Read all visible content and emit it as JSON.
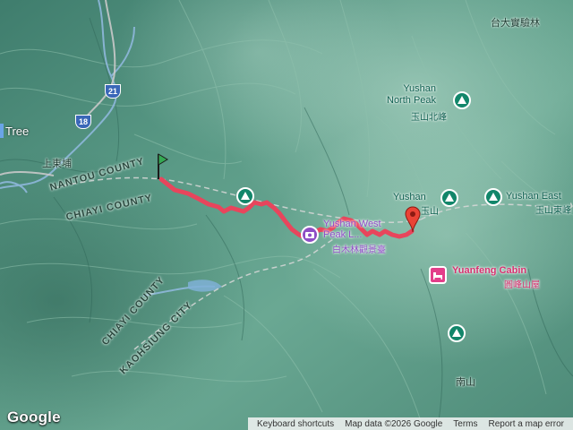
{
  "map": {
    "route_color": "#e8455c",
    "start_marker_color": "#34a853",
    "end_marker_color": "#ea4335"
  },
  "labels": {
    "tree": "Tree",
    "shangdongpu": "上東埔",
    "nantou_county": "NANTOU COUNTY",
    "chiayi_county_upper": "CHIAYI COUNTY",
    "chiayi_county_lower": "CHIAYI COUNTY",
    "kaohsiung_city": "KAOHSIUNG CITY",
    "ntu_forest": "台大實驗林",
    "yushan_north_peak": "Yushan\nNorth Peak",
    "yushan_north_peak_zh": "玉山北峰",
    "yushan": "Yushan",
    "yushan_zh": "玉山",
    "yushan_east": "Yushan East",
    "yushan_east_zh": "玉山東峰",
    "yushan_west_peak": "Yushan West\nPeak L...",
    "yushan_west_zh": "白木林觀景臺",
    "yuanfeng_cabin": "Yuanfeng Cabin",
    "yuanfeng_cabin_zh": "圓峰山屋",
    "nanshan": "南山"
  },
  "shields": {
    "route_21": "21",
    "route_18": "18"
  },
  "footer": {
    "logo": "Google",
    "keyboard_shortcuts": "Keyboard shortcuts",
    "map_data": "Map data ©2026 Google",
    "terms": "Terms",
    "report": "Report a map error"
  },
  "icons": {
    "park": "hiking-icon",
    "hotel": "bed-icon",
    "viewpoint": "camera-icon"
  }
}
